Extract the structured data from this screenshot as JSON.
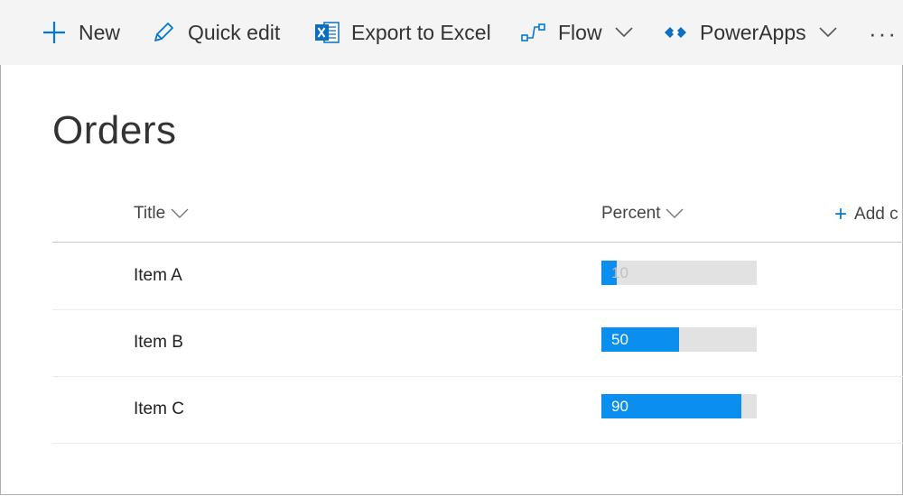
{
  "toolbar": {
    "new_label": "New",
    "quick_edit_label": "Quick edit",
    "export_label": "Export to Excel",
    "flow_label": "Flow",
    "powerapps_label": "PowerApps",
    "more_label": "···"
  },
  "page": {
    "title": "Orders"
  },
  "columns": {
    "title": "Title",
    "percent": "Percent",
    "add_column": "Add c"
  },
  "rows": [
    {
      "title": "Item A",
      "percent": 10,
      "percent_label": "10"
    },
    {
      "title": "Item B",
      "percent": 50,
      "percent_label": "50"
    },
    {
      "title": "Item C",
      "percent": 90,
      "percent_label": "90"
    }
  ],
  "colors": {
    "accent": "#0078d4",
    "bar_fill": "#0a8ef0",
    "bar_track": "#e2e2e2",
    "excel_green": "#217346"
  }
}
